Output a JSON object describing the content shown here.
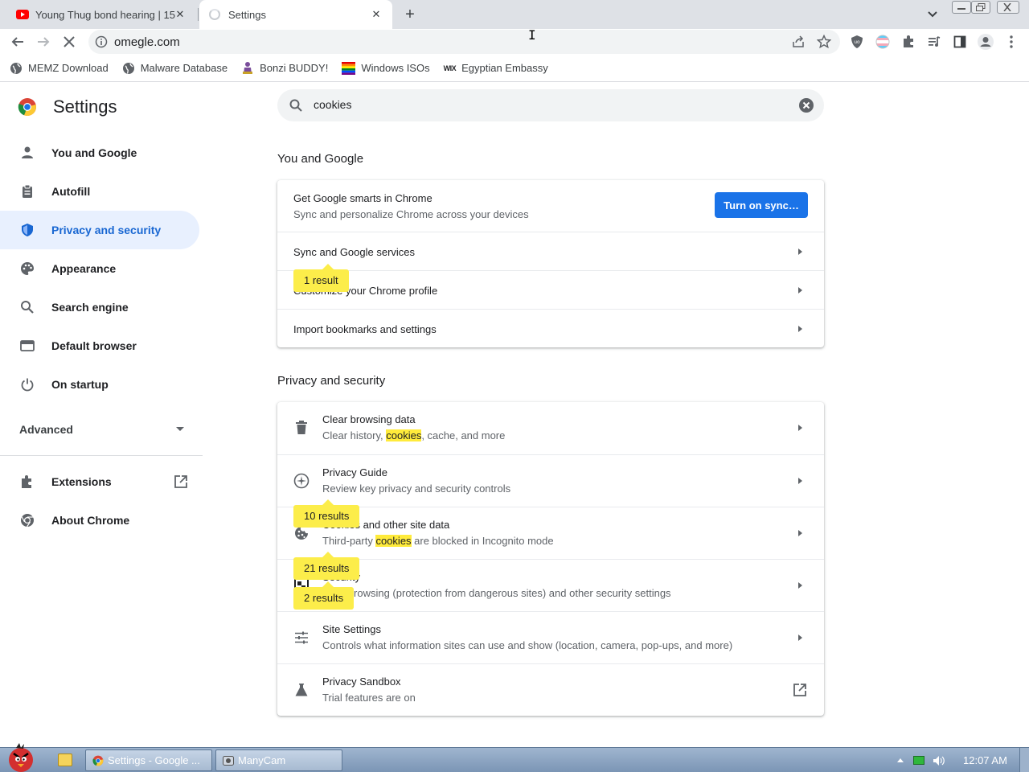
{
  "tabs": [
    {
      "title": "Young Thug bond hearing | 15",
      "active": false
    },
    {
      "title": "Settings",
      "active": true
    }
  ],
  "toolbar": {
    "url": "omegle.com"
  },
  "bookmarks": [
    {
      "label": "MEMZ Download",
      "icon": "globe-icon"
    },
    {
      "label": "Malware Database",
      "icon": "globe-icon"
    },
    {
      "label": "Bonzi BUDDY!",
      "icon": "bonzi-icon"
    },
    {
      "label": "Windows ISOs",
      "icon": "windows-icon"
    },
    {
      "label": "Egyptian Embassy",
      "icon": "wix-icon"
    }
  ],
  "wix_text": "WiX",
  "settings": {
    "title": "Settings",
    "search_value": "cookies"
  },
  "nav": {
    "items": [
      {
        "label": "You and Google",
        "icon": "person-icon"
      },
      {
        "label": "Autofill",
        "icon": "clipboard-icon"
      },
      {
        "label": "Privacy and security",
        "icon": "shield-icon",
        "active": true
      },
      {
        "label": "Appearance",
        "icon": "palette-icon"
      },
      {
        "label": "Search engine",
        "icon": "search-icon"
      },
      {
        "label": "Default browser",
        "icon": "browser-icon"
      },
      {
        "label": "On startup",
        "icon": "power-icon"
      }
    ],
    "advanced": "Advanced",
    "extensions": "Extensions",
    "about": "About Chrome"
  },
  "you_and_google": {
    "section_title": "You and Google",
    "smarts_title": "Get Google smarts in Chrome",
    "smarts_sub": "Sync and personalize Chrome across your devices",
    "sync_button": "Turn on sync…",
    "rows": [
      "Sync and Google services",
      "Customize your Chrome profile",
      "Import bookmarks and settings"
    ]
  },
  "privacy": {
    "section_title": "Privacy and security",
    "rows": [
      {
        "title": "Clear browsing data",
        "sub_before": "Clear history, ",
        "sub_hl": "cookies",
        "sub_after": ", cache, and more",
        "icon": "trash-icon"
      },
      {
        "title": "Privacy Guide",
        "sub": "Review key privacy and security controls",
        "icon": "privacy-guide-icon"
      },
      {
        "title": "Cookies and other site data",
        "sub_before": "Third-party ",
        "sub_hl": "cookies",
        "sub_after": " are blocked in Incognito mode",
        "icon": "cookie-icon"
      },
      {
        "title": "Security",
        "sub": "Safe Browsing (protection from dangerous sites) and other security settings",
        "icon": "security-icon"
      },
      {
        "title": "Site Settings",
        "sub": "Controls what information sites can use and show (location, camera, pop-ups, and more)",
        "icon": "sliders-icon"
      },
      {
        "title": "Privacy Sandbox",
        "sub": "Trial features are on",
        "icon": "flask-icon"
      }
    ]
  },
  "bubbles": [
    "1 result",
    "10 results",
    "21 results",
    "2 results"
  ],
  "taskbar": {
    "tasks": [
      "Settings - Google ...",
      "ManyCam"
    ],
    "clock": "12:07 AM"
  },
  "colors": {
    "accent": "#1a73e8",
    "highlight": "#fced4a",
    "nav_active_bg": "#e8f0fe"
  }
}
